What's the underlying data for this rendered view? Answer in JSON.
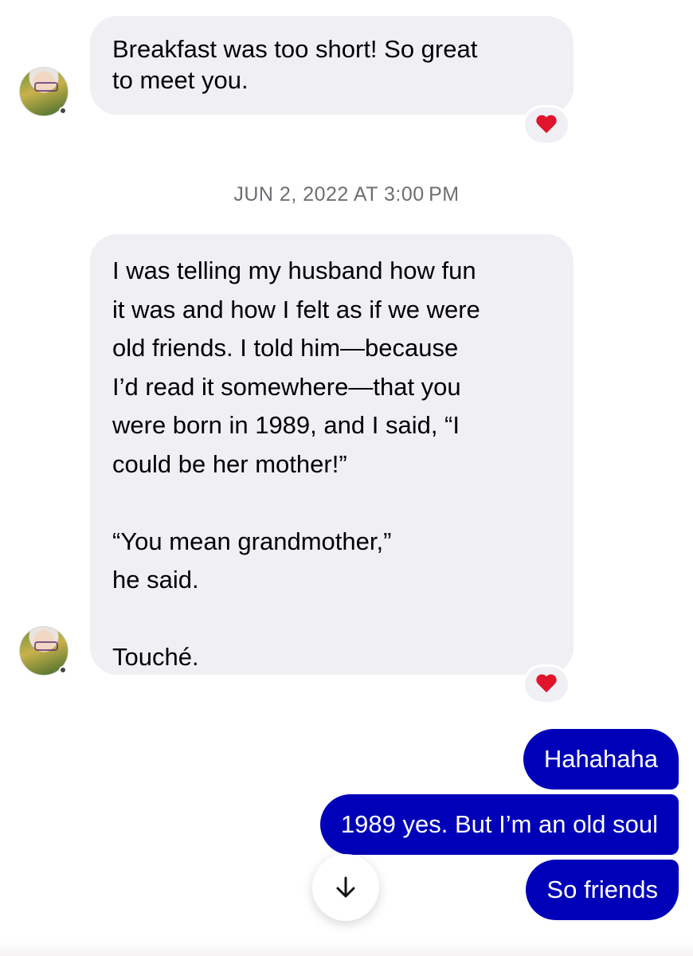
{
  "thread": {
    "messages_incoming": [
      {
        "text": "Breakfast was too short! So great\nto meet you.",
        "reaction": "heart"
      },
      {
        "text": "I was telling my husband how fun\nit was and how I felt as if we were\nold friends. I told him—because\nI’d read it somewhere—that you\nwere born in 1989, and I said, “I\ncould be her mother!”\n\n“You mean grandmother,”\nhe said.\n\nTouché.",
        "reaction": "heart"
      }
    ],
    "timestamp": "JUN 2, 2022 AT 3:00 PM",
    "messages_outgoing": [
      {
        "text": "Hahahaha"
      },
      {
        "text": "1989 yes. But I’m an old soul"
      },
      {
        "text": "So friends"
      }
    ]
  },
  "colors": {
    "incoming_bubble": "#f0f0f4",
    "outgoing_bubble": "#0000b8",
    "reaction_heart": "#e0142a",
    "timestamp_text": "#6e6e73"
  },
  "icons": {
    "reaction": "heart-icon",
    "scroll": "arrow-down-icon"
  }
}
